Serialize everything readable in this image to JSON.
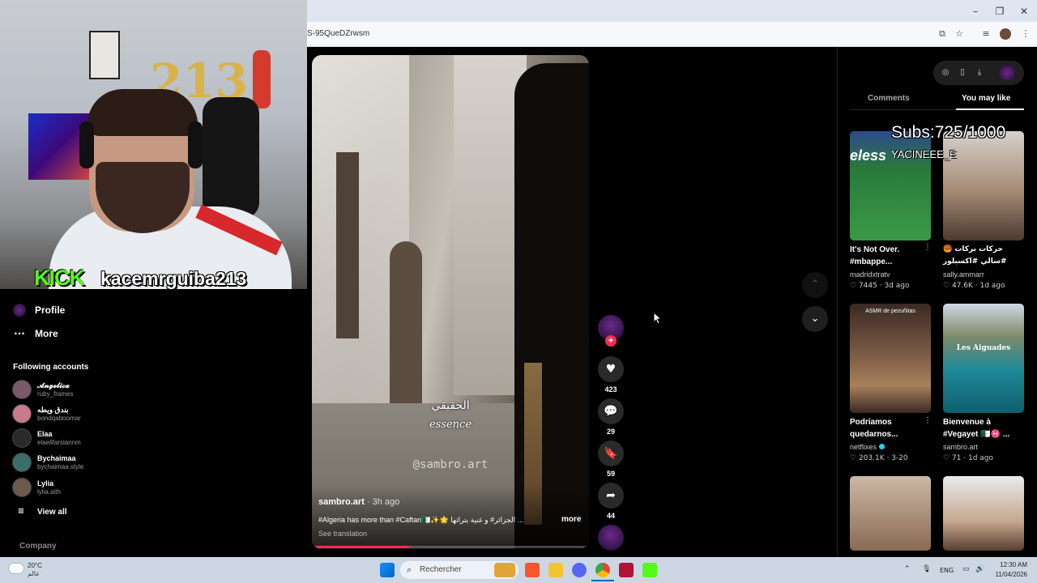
{
  "browser": {
    "url_fragment": "S-95QueDZrwsm",
    "window_controls": {
      "minimize": "–",
      "restore": "❐",
      "close": "✕"
    },
    "toolbar_icons": [
      "install-app-icon",
      "bookmark-star-icon",
      "media-controls-icon",
      "profile-avatar-icon",
      "kebab-menu-icon"
    ]
  },
  "webcam": {
    "balloon_text": "213",
    "brand": "KICK",
    "username": "kacemrguiba213"
  },
  "sidebar": {
    "nav": [
      {
        "label": "Profile",
        "icon": "profile-icon"
      },
      {
        "label": "More",
        "icon": "more-dots-icon"
      }
    ],
    "following_heading": "Following accounts",
    "accounts": [
      {
        "name": "𝓐𝓷𝓰𝓮𝓵𝓲𝓬𝓪",
        "handle": "ruby_frames",
        "color": "#7a5a6a"
      },
      {
        "name": "بندق ويطه",
        "handle": "bondqaboomar",
        "color": "#c77a8a"
      },
      {
        "name": "Elaa",
        "handle": "elaelifarslannm",
        "color": "#2a2a2a"
      },
      {
        "name": "Bychaimaa",
        "handle": "bychaimaa.style",
        "color": "#3b6e6a"
      },
      {
        "name": "Lylia",
        "handle": "lylia.aith",
        "color": "#6b5a50"
      }
    ],
    "view_all": "View all",
    "company": "Company"
  },
  "video": {
    "overlay_arabic": "الحقيقي",
    "overlay_word": "essence",
    "watermark": "@sambro.art",
    "author": "sambro.art",
    "age": " · 3h ago",
    "caption": "#Algeria has more than #Caftan🇩🇿✨🌟 الجزائر# و غنية بتراثها ...",
    "more": "more",
    "see_translation": "See translation",
    "progress": 0.35
  },
  "actions": {
    "likes": "423",
    "comments": "29",
    "saves": "59",
    "shares": "44"
  },
  "right_panel": {
    "tabs": [
      "Comments",
      "You may like"
    ],
    "active_tab": "You may like",
    "stream_overlay": {
      "subs": "Subs:725/1000",
      "name": "YACINEEE_E"
    },
    "items": [
      {
        "title": "It's Not Over. #mbappe...",
        "author": "madridxtratv",
        "likes": "7445",
        "age": "3d ago",
        "verified": false
      },
      {
        "title": "حركات بركات 🥮 #سالي #اكسبلور",
        "author": "sally.ammarr",
        "likes": "47.6K",
        "age": "1d ago",
        "verified": false
      },
      {
        "title": "Podríamos quedarnos...",
        "author": "netflixes",
        "likes": "203.1K",
        "age": "3-20",
        "verified": true,
        "thumb_text": "ASMR de pezuñitas"
      },
      {
        "title": "Bienvenue à #Vegayet 🇩🇿♓ ...",
        "author": "sambro.art",
        "likes": "71",
        "age": "1d ago",
        "verified": false,
        "thumb_text": "Les Aiguades"
      }
    ]
  },
  "taskbar": {
    "temperature": "20°C",
    "condition": "عالم",
    "search_placeholder": "Rechercher",
    "lang": "ENG",
    "time": "12:30 AM",
    "date": "11/04/2026"
  }
}
